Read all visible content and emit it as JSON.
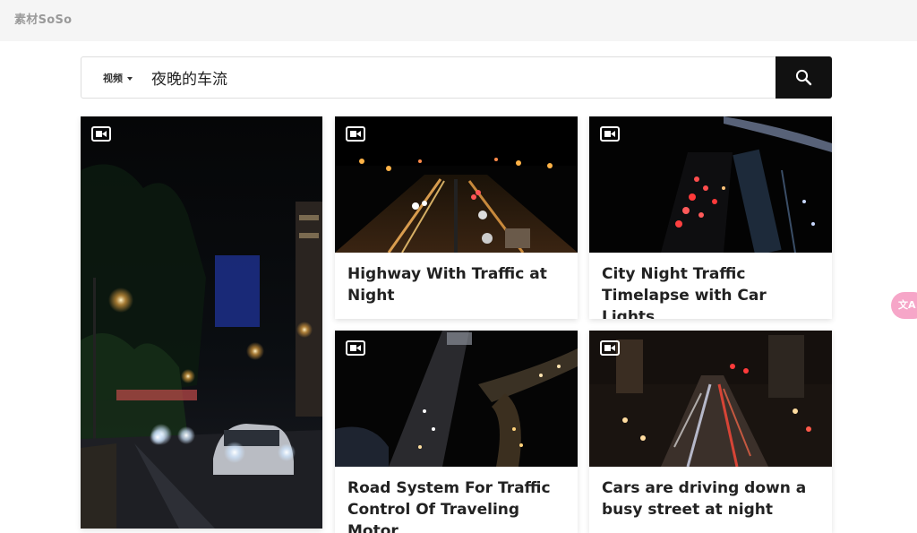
{
  "header": {
    "logo": "素材SoSo"
  },
  "search": {
    "type_label": "视频",
    "query": "夜晚的车流",
    "button_icon": "search-icon"
  },
  "results": [
    {
      "title": "",
      "icon": "video-camera-icon"
    },
    {
      "title": "Highway With Traffic at Night",
      "icon": "video-camera-icon"
    },
    {
      "title": "City Night Traffic Timelapse with Car Lights",
      "icon": "video-camera-icon"
    },
    {
      "title": "Road System For Traffic Control Of Traveling Motor",
      "icon": "video-camera-icon"
    },
    {
      "title": "Cars are driving down a busy street at night",
      "icon": "video-camera-icon"
    }
  ],
  "floating": {
    "translate_label": "文A"
  },
  "colors": {
    "search_button": "#111111",
    "topbar": "#f5f5f5",
    "translate_bubble": "#f6a6c8"
  }
}
